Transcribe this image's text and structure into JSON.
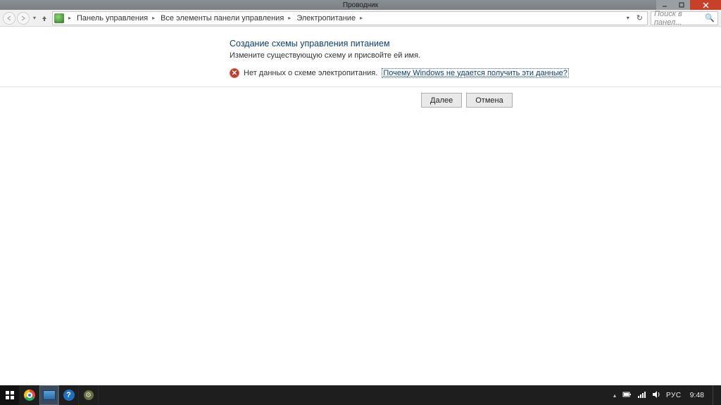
{
  "window": {
    "title": "Проводник"
  },
  "breadcrumb": {
    "items": [
      "Панель управления",
      "Все элементы панели управления",
      "Электропитание"
    ]
  },
  "search": {
    "placeholder": "Поиск в панел..."
  },
  "page": {
    "heading": "Создание схемы управления питанием",
    "subheading": "Измените существующую схему и присвойте ей имя.",
    "error_text": "Нет данных о схеме электропитания.",
    "error_link": "Почему Windows не удается получить эти данные?",
    "btn_next": "Далее",
    "btn_cancel": "Отмена"
  },
  "tray": {
    "lang": "РУС",
    "time": "9:48"
  }
}
